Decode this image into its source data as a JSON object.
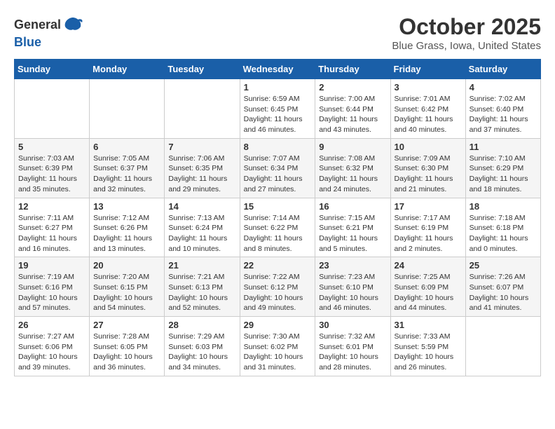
{
  "header": {
    "logo_general": "General",
    "logo_blue": "Blue",
    "month": "October 2025",
    "location": "Blue Grass, Iowa, United States"
  },
  "weekdays": [
    "Sunday",
    "Monday",
    "Tuesday",
    "Wednesday",
    "Thursday",
    "Friday",
    "Saturday"
  ],
  "weeks": [
    [
      {
        "day": "",
        "info": ""
      },
      {
        "day": "",
        "info": ""
      },
      {
        "day": "",
        "info": ""
      },
      {
        "day": "1",
        "info": "Sunrise: 6:59 AM\nSunset: 6:45 PM\nDaylight: 11 hours\nand 46 minutes."
      },
      {
        "day": "2",
        "info": "Sunrise: 7:00 AM\nSunset: 6:44 PM\nDaylight: 11 hours\nand 43 minutes."
      },
      {
        "day": "3",
        "info": "Sunrise: 7:01 AM\nSunset: 6:42 PM\nDaylight: 11 hours\nand 40 minutes."
      },
      {
        "day": "4",
        "info": "Sunrise: 7:02 AM\nSunset: 6:40 PM\nDaylight: 11 hours\nand 37 minutes."
      }
    ],
    [
      {
        "day": "5",
        "info": "Sunrise: 7:03 AM\nSunset: 6:39 PM\nDaylight: 11 hours\nand 35 minutes."
      },
      {
        "day": "6",
        "info": "Sunrise: 7:05 AM\nSunset: 6:37 PM\nDaylight: 11 hours\nand 32 minutes."
      },
      {
        "day": "7",
        "info": "Sunrise: 7:06 AM\nSunset: 6:35 PM\nDaylight: 11 hours\nand 29 minutes."
      },
      {
        "day": "8",
        "info": "Sunrise: 7:07 AM\nSunset: 6:34 PM\nDaylight: 11 hours\nand 27 minutes."
      },
      {
        "day": "9",
        "info": "Sunrise: 7:08 AM\nSunset: 6:32 PM\nDaylight: 11 hours\nand 24 minutes."
      },
      {
        "day": "10",
        "info": "Sunrise: 7:09 AM\nSunset: 6:30 PM\nDaylight: 11 hours\nand 21 minutes."
      },
      {
        "day": "11",
        "info": "Sunrise: 7:10 AM\nSunset: 6:29 PM\nDaylight: 11 hours\nand 18 minutes."
      }
    ],
    [
      {
        "day": "12",
        "info": "Sunrise: 7:11 AM\nSunset: 6:27 PM\nDaylight: 11 hours\nand 16 minutes."
      },
      {
        "day": "13",
        "info": "Sunrise: 7:12 AM\nSunset: 6:26 PM\nDaylight: 11 hours\nand 13 minutes."
      },
      {
        "day": "14",
        "info": "Sunrise: 7:13 AM\nSunset: 6:24 PM\nDaylight: 11 hours\nand 10 minutes."
      },
      {
        "day": "15",
        "info": "Sunrise: 7:14 AM\nSunset: 6:22 PM\nDaylight: 11 hours\nand 8 minutes."
      },
      {
        "day": "16",
        "info": "Sunrise: 7:15 AM\nSunset: 6:21 PM\nDaylight: 11 hours\nand 5 minutes."
      },
      {
        "day": "17",
        "info": "Sunrise: 7:17 AM\nSunset: 6:19 PM\nDaylight: 11 hours\nand 2 minutes."
      },
      {
        "day": "18",
        "info": "Sunrise: 7:18 AM\nSunset: 6:18 PM\nDaylight: 11 hours\nand 0 minutes."
      }
    ],
    [
      {
        "day": "19",
        "info": "Sunrise: 7:19 AM\nSunset: 6:16 PM\nDaylight: 10 hours\nand 57 minutes."
      },
      {
        "day": "20",
        "info": "Sunrise: 7:20 AM\nSunset: 6:15 PM\nDaylight: 10 hours\nand 54 minutes."
      },
      {
        "day": "21",
        "info": "Sunrise: 7:21 AM\nSunset: 6:13 PM\nDaylight: 10 hours\nand 52 minutes."
      },
      {
        "day": "22",
        "info": "Sunrise: 7:22 AM\nSunset: 6:12 PM\nDaylight: 10 hours\nand 49 minutes."
      },
      {
        "day": "23",
        "info": "Sunrise: 7:23 AM\nSunset: 6:10 PM\nDaylight: 10 hours\nand 46 minutes."
      },
      {
        "day": "24",
        "info": "Sunrise: 7:25 AM\nSunset: 6:09 PM\nDaylight: 10 hours\nand 44 minutes."
      },
      {
        "day": "25",
        "info": "Sunrise: 7:26 AM\nSunset: 6:07 PM\nDaylight: 10 hours\nand 41 minutes."
      }
    ],
    [
      {
        "day": "26",
        "info": "Sunrise: 7:27 AM\nSunset: 6:06 PM\nDaylight: 10 hours\nand 39 minutes."
      },
      {
        "day": "27",
        "info": "Sunrise: 7:28 AM\nSunset: 6:05 PM\nDaylight: 10 hours\nand 36 minutes."
      },
      {
        "day": "28",
        "info": "Sunrise: 7:29 AM\nSunset: 6:03 PM\nDaylight: 10 hours\nand 34 minutes."
      },
      {
        "day": "29",
        "info": "Sunrise: 7:30 AM\nSunset: 6:02 PM\nDaylight: 10 hours\nand 31 minutes."
      },
      {
        "day": "30",
        "info": "Sunrise: 7:32 AM\nSunset: 6:01 PM\nDaylight: 10 hours\nand 28 minutes."
      },
      {
        "day": "31",
        "info": "Sunrise: 7:33 AM\nSunset: 5:59 PM\nDaylight: 10 hours\nand 26 minutes."
      },
      {
        "day": "",
        "info": ""
      }
    ]
  ]
}
